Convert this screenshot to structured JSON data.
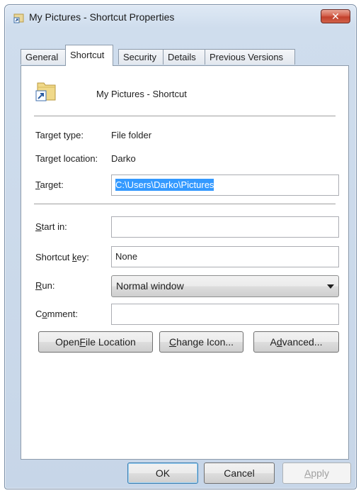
{
  "window": {
    "title": "My Pictures - Shortcut Properties"
  },
  "tabs": [
    {
      "label": "General"
    },
    {
      "label": "Shortcut"
    },
    {
      "label": "Security"
    },
    {
      "label": "Details"
    },
    {
      "label": "Previous Versions"
    }
  ],
  "header": {
    "name": "My Pictures - Shortcut"
  },
  "fields": {
    "target_type_label": "Target type:",
    "target_type_value": "File folder",
    "target_location_label": "Target location:",
    "target_location_value": "Darko",
    "target_label_pre": "",
    "target_label_key": "T",
    "target_label_post": "arget:",
    "target_value": "C:\\Users\\Darko\\Pictures",
    "start_in_label_key": "S",
    "start_in_label_post": "tart in:",
    "start_in_value": "",
    "shortcut_key_label_pre": "Shortcut ",
    "shortcut_key_label_key": "k",
    "shortcut_key_label_post": "ey:",
    "shortcut_key_value": "None",
    "run_label_key": "R",
    "run_label_post": "un:",
    "run_value": "Normal window",
    "comment_label_pre": "C",
    "comment_label_key": "o",
    "comment_label_post": "mment:",
    "comment_value": ""
  },
  "buttons": {
    "open_file_location_pre": "Open ",
    "open_file_location_key": "F",
    "open_file_location_post": "ile Location",
    "change_icon_key": "C",
    "change_icon_post": "hange Icon...",
    "advanced_pre": "A",
    "advanced_key": "d",
    "advanced_post": "vanced...",
    "ok": "OK",
    "cancel": "Cancel",
    "apply_key": "A",
    "apply_post": "pply"
  },
  "colors": {
    "selection": "#3399ff",
    "close": "#c2402c"
  },
  "icons": {
    "title": "shortcut-icon",
    "header": "folder-shortcut-icon",
    "close": "close-icon"
  }
}
